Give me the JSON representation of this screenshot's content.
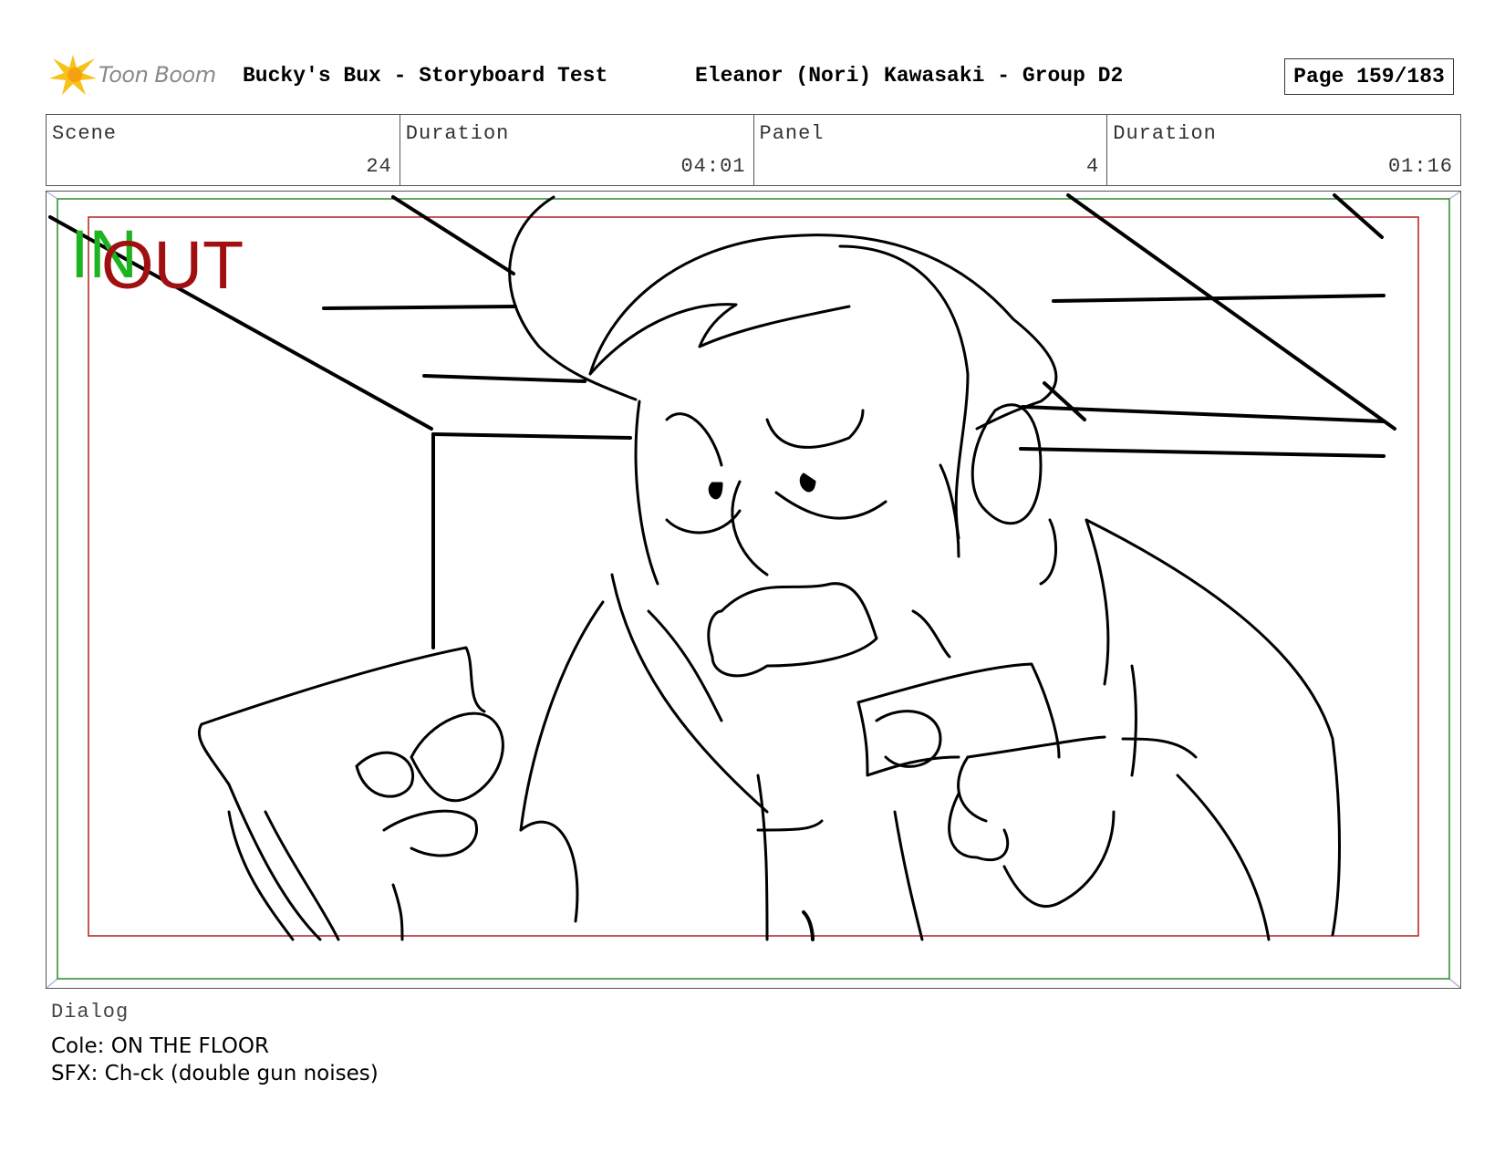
{
  "header": {
    "logo_text": "Toon Boom",
    "title": "Bucky's Bux - Storyboard Test",
    "subtitle": "Eleanor (Nori) Kawasaki - Group D2",
    "page": "Page 159/183"
  },
  "info": {
    "scene_label": "Scene",
    "scene_value": "24",
    "scene_duration_label": "Duration",
    "scene_duration_value": "04:01",
    "panel_label": "Panel",
    "panel_value": "4",
    "panel_duration_label": "Duration",
    "panel_duration_value": "01:16"
  },
  "panel_frame": {
    "in_label": "IN",
    "out_label": "OUT",
    "in_color": "#1fb41f",
    "out_color": "#a01010",
    "safe_frame_color": "#2a8a2a",
    "action_frame_color": "#b02020"
  },
  "dialog": {
    "label": "Dialog",
    "lines": [
      "Cole: ON THE FLOOR",
      "SFX: Ch-ck (double gun noises)"
    ]
  }
}
